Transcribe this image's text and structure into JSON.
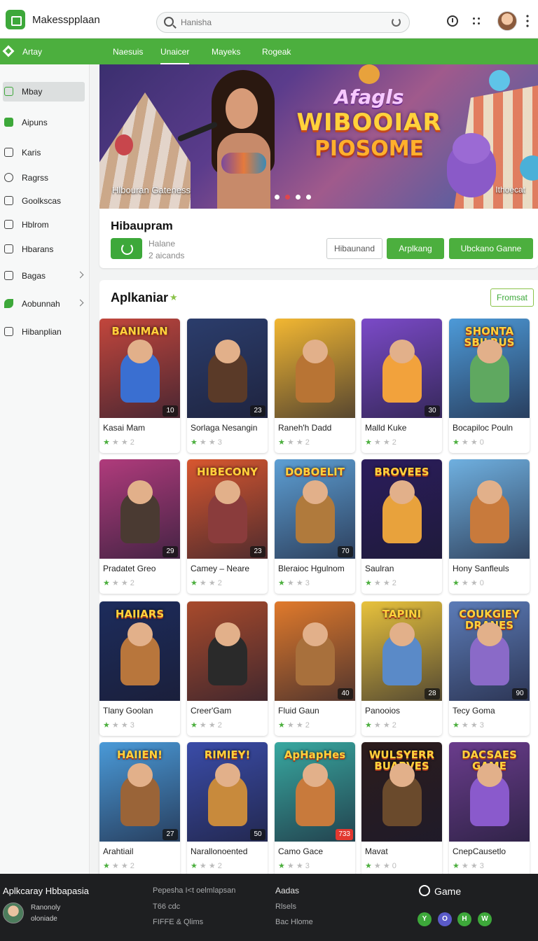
{
  "header": {
    "brand": "Makesspplaan",
    "search_placeholder": "Hanisha"
  },
  "nav": {
    "label": "Artay",
    "tabs": [
      "Naesuis",
      "Unaicer",
      "Mayeks",
      "Rogeak"
    ],
    "active_tab": "Unaicer"
  },
  "sidebar": {
    "items": [
      {
        "label": "Mbay",
        "icon": "square-icon",
        "active": true
      },
      {
        "label": "Aipuns",
        "icon": "green-app-icon"
      },
      {
        "label": "Karis",
        "icon": "image-icon"
      },
      {
        "label": "Ragrss",
        "icon": "hexagon-icon"
      },
      {
        "label": "Goolkscas",
        "icon": "box-icon"
      },
      {
        "label": "Hblrom",
        "icon": "tag-icon"
      },
      {
        "label": "Hbarans",
        "icon": "grid-icon"
      },
      {
        "label": "Bagas",
        "icon": "folder-icon",
        "chevron": true
      },
      {
        "label": "Aobunnah",
        "icon": "green-leaf-icon",
        "chevron": true
      },
      {
        "label": "Hibanplian",
        "icon": "shield-icon"
      }
    ]
  },
  "hero": {
    "art_line1": "Afagls",
    "art_line2": "WIBOOIAR",
    "art_line3": "PIOSOME",
    "caption_left": "Hlbouran Gateness",
    "caption_right": "Ithoecat",
    "slide_count": 4,
    "active_slide": 2
  },
  "featured": {
    "title": "Hibaupram",
    "line1": "Halane",
    "line2": "2 aicands",
    "buttons": {
      "outline": "Hibaunand",
      "primary": "Arplkang",
      "secondary": "Ubckano Ganne"
    }
  },
  "section": {
    "title": "Aplkaniar",
    "action": "Fromsat"
  },
  "cards": [
    {
      "name": "Kasai Mam",
      "badge": "10",
      "rating": "2",
      "green_stars": 1,
      "thumb": "#c2463c",
      "fig": "#3a6fd1",
      "art_text": "BANIMAN"
    },
    {
      "name": "Sorlaga Nesangin",
      "badge": "23",
      "rating": "3",
      "green_stars": 1,
      "thumb": "#2b3d6c",
      "fig": "#5a3a28",
      "art_text": ""
    },
    {
      "name": "Raneh'h Dadd",
      "badge": "",
      "rating": "2",
      "green_stars": 1,
      "thumb": "#f2b732",
      "fig": "#b87434",
      "art_text": ""
    },
    {
      "name": "Malld Kuke",
      "badge": "30",
      "rating": "2",
      "green_stars": 1,
      "thumb": "#7b4ac8",
      "fig": "#f2a23c",
      "art_text": ""
    },
    {
      "name": "Bocapiloc Pouln",
      "badge": "",
      "rating": "0",
      "green_stars": 1,
      "thumb": "#4d9ad8",
      "fig": "#5fa860",
      "art_text": "SHONTA SBILRUS"
    },
    {
      "name": "Pradatet Greo",
      "badge": "29",
      "rating": "2",
      "green_stars": 1,
      "thumb": "#b03b7c",
      "fig": "#4a3a32",
      "art_text": ""
    },
    {
      "name": "Camey – Neare",
      "badge": "23",
      "rating": "2",
      "green_stars": 1,
      "thumb": "#d8572f",
      "fig": "#8a3c3c",
      "art_text": "HIBECONY"
    },
    {
      "name": "Bleraioc Hgulnom",
      "badge": "70",
      "rating": "3",
      "green_stars": 1,
      "thumb": "#5d9fd4",
      "fig": "#b07a3c",
      "art_text": "DOBOELIT"
    },
    {
      "name": "Saulran",
      "badge": "",
      "rating": "2",
      "green_stars": 1,
      "thumb": "#2b1c5c",
      "fig": "#e8a23c",
      "art_text": "BROVEES"
    },
    {
      "name": "Hony Sanfleuls",
      "badge": "",
      "rating": "0",
      "green_stars": 1,
      "thumb": "#6fb0e0",
      "fig": "#c87a3c",
      "art_text": ""
    },
    {
      "name": "Tlany Goolan",
      "badge": "",
      "rating": "3",
      "green_stars": 1,
      "thumb": "#1c2c5c",
      "fig": "#b8763c",
      "art_text": "HAIIARS"
    },
    {
      "name": "Creer'Gam",
      "badge": "",
      "rating": "2",
      "green_stars": 1,
      "thumb": "#a84a2c",
      "fig": "#2a2a2a",
      "art_text": ""
    },
    {
      "name": "Fluid Gaun",
      "badge": "40",
      "rating": "2",
      "green_stars": 1,
      "thumb": "#e07a2c",
      "fig": "#a8703c",
      "art_text": ""
    },
    {
      "name": "Panooios",
      "badge": "28",
      "rating": "2",
      "green_stars": 1,
      "thumb": "#e8c23c",
      "fig": "#5a8ac8",
      "art_text": "TAPINI"
    },
    {
      "name": "Tecy Goma",
      "badge": "90",
      "rating": "3",
      "green_stars": 1,
      "thumb": "#5c7cb8",
      "fig": "#8a6ac8",
      "art_text": "COUKGIEY DRANES"
    },
    {
      "name": "Arahtiail",
      "badge": "27",
      "rating": "2",
      "green_stars": 1,
      "thumb": "#4a9ad8",
      "fig": "#9a6438",
      "art_text": "HAIIEN!"
    },
    {
      "name": "Narallonoented",
      "badge": "50",
      "rating": "2",
      "green_stars": 1,
      "thumb": "#3a4ca8",
      "fig": "#c88a3c",
      "art_text": "RIMIEY!"
    },
    {
      "name": "Camo Gace",
      "badge": "733",
      "badge_red": true,
      "rating": "3",
      "green_stars": 1,
      "thumb": "#38a8a0",
      "fig": "#c87a3c",
      "art_text": "ApHapHes"
    },
    {
      "name": "Mavat",
      "badge": "",
      "rating": "0",
      "green_stars": 1,
      "thumb": "#2c1c1c",
      "fig": "#6a4a2c",
      "art_text": "WULSYERR BUABVES"
    },
    {
      "name": "CnepCausetlo",
      "badge": "",
      "rating": "3",
      "green_stars": 1,
      "thumb": "#6a3c8c",
      "fig": "#8a5acc",
      "art_text": "DACSAES GAME"
    }
  ],
  "footer": {
    "title": "Aplkcaray Hbbapasia",
    "user_line1": "Ranonoly",
    "user_line2": "oloniade",
    "col1": [
      "Pepesha I<t oelmlapsan",
      "T66 cdc",
      "FIFFE & Qlims"
    ],
    "col2_head": "Aadas",
    "col2": [
      "Rlsels",
      "Bac Hlome"
    ],
    "game_label": "Game",
    "socials": [
      {
        "letter": "Y",
        "color": "#3da83a"
      },
      {
        "letter": "O",
        "color": "#5a5ac8"
      },
      {
        "letter": "H",
        "color": "#3da83a"
      },
      {
        "letter": "W",
        "color": "#3da83a"
      }
    ]
  },
  "colors": {
    "accent": "#4caf3e",
    "footer_bg": "#1e1f21"
  }
}
